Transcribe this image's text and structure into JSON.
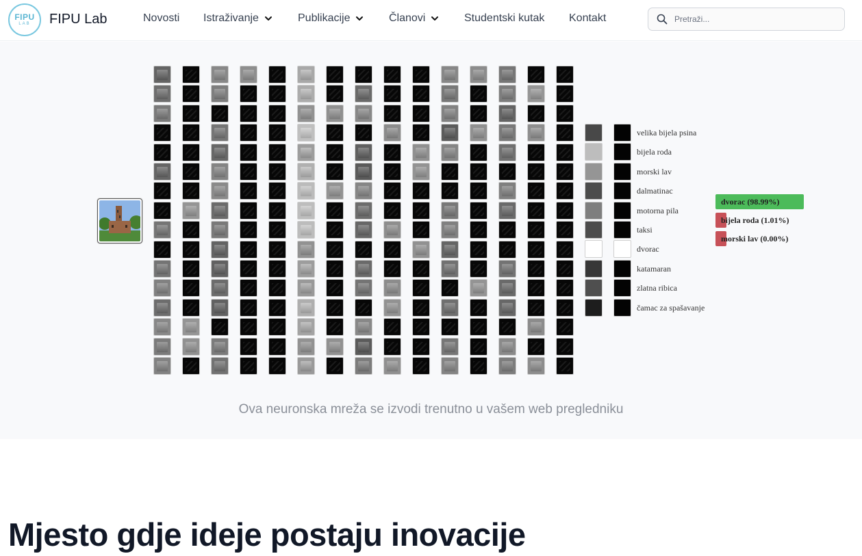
{
  "brand": {
    "logo_line1": "FIPU",
    "logo_line2": "LAB",
    "name": "FIPU Lab"
  },
  "nav": {
    "items": [
      {
        "label": "Novosti",
        "dropdown": false
      },
      {
        "label": "Istraživanje",
        "dropdown": true
      },
      {
        "label": "Publikacije",
        "dropdown": true
      },
      {
        "label": "Članovi",
        "dropdown": true
      },
      {
        "label": "Studentski kutak",
        "dropdown": false
      },
      {
        "label": "Kontakt",
        "dropdown": false
      }
    ]
  },
  "search": {
    "placeholder": "Pretraži...",
    "value": ""
  },
  "network": {
    "input_image": "castle-photo",
    "classes": [
      {
        "label": "velika bijela psina",
        "activation": 0.22
      },
      {
        "label": "bijela roda",
        "activation": 0.72
      },
      {
        "label": "morski lav",
        "activation": 0.55
      },
      {
        "label": "dalmatinac",
        "activation": 0.24
      },
      {
        "label": "motorna pila",
        "activation": 0.45
      },
      {
        "label": "taksi",
        "activation": 0.24
      },
      {
        "label": "dvorac",
        "activation": 1.0
      },
      {
        "label": "katamaran",
        "activation": 0.15
      },
      {
        "label": "zlatna ribica",
        "activation": 0.25
      },
      {
        "label": "čamac za spašavanje",
        "activation": 0.04
      }
    ],
    "predictions": [
      {
        "label": "dvorac (98.99%)",
        "probability": 0.9899,
        "color": "#4cbb5a"
      },
      {
        "label": "bijela roda (1.01%)",
        "probability": 0.0101,
        "color": "#c75158"
      },
      {
        "label": "morski lav (0.00%)",
        "probability": 0.0,
        "color": "#c75158"
      }
    ]
  },
  "caption": "Ova neuronska mreža se izvodi trenutno u vašem web pregledniku",
  "hero": {
    "title": "Mjesto gdje ideje postaju inovacije"
  },
  "colors": {
    "accent_green": "#4cbb5a",
    "accent_red": "#c75158",
    "logo": "#5bb6d3"
  }
}
